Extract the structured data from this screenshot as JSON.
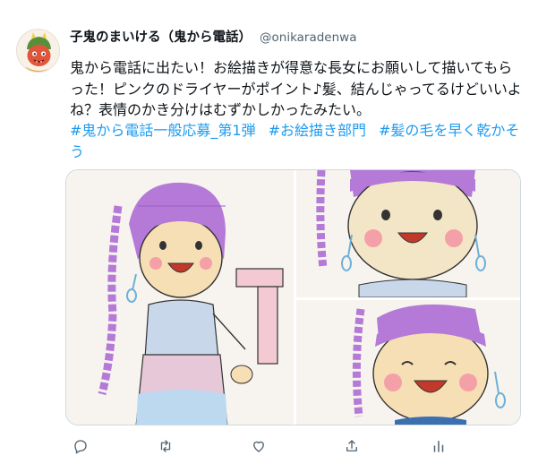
{
  "author": {
    "display_name": "子鬼のまいける（鬼から電話）",
    "handle": "@onikaradenwa"
  },
  "tweet": {
    "text_line1": "鬼から電話に出たい！お絵描きが得意な長女にお願いして描いてもらった！ピンクのドライヤーがポイント♪髪、結んじゃってるけどいいよね？表情のかき分けはむずかしかったみたい。",
    "hashtags": [
      "#鬼から電話一般応募_第1弾",
      "#お絵描き部門",
      "#髪の毛を早く乾かそう"
    ]
  },
  "media": {
    "images": [
      {
        "name": "drawing-full-body"
      },
      {
        "name": "drawing-face-closeup"
      },
      {
        "name": "drawing-smiling-closeup"
      }
    ]
  },
  "actions": {
    "icons": [
      "reply-icon",
      "retweet-icon",
      "like-icon",
      "share-icon",
      "analytics-icon"
    ]
  },
  "colors": {
    "link": "#1d9bf0",
    "muted": "#536471",
    "hair_purple": "#b57ad8"
  }
}
